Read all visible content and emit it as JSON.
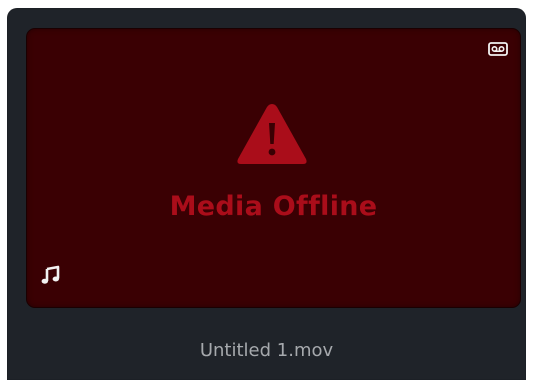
{
  "clip": {
    "status_text": "Media Offline",
    "name": "Untitled 1.mov"
  },
  "icons": {
    "top_right": "tape-icon",
    "center": "warning-triangle-icon",
    "bottom_left": "audio-note-icon"
  },
  "colors": {
    "card_background": "#1f2329",
    "thumbnail_background": "#3a0003",
    "warning_red": "#aa0d1a",
    "clip_name_text": "#a6a9ad",
    "icon_white": "#f2f2f2"
  }
}
